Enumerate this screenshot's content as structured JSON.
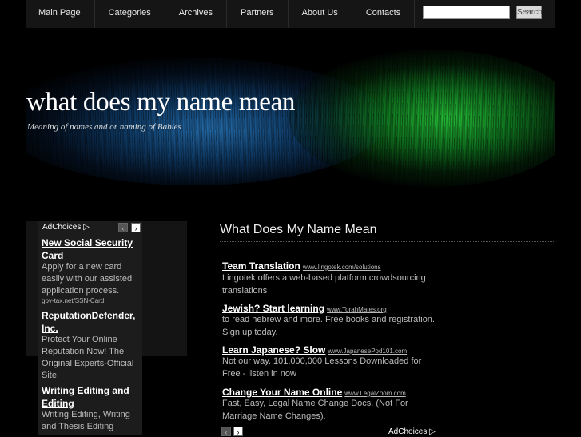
{
  "nav": {
    "items": [
      "Main Page",
      "Categories",
      "Archives",
      "Partners",
      "About Us",
      "Contacts"
    ],
    "search_button": "Search",
    "search_value": ""
  },
  "header": {
    "title": "what does my name mean",
    "tagline": "Meaning of names and or naming of Babies"
  },
  "sidebar": {
    "adchoices": "AdChoices",
    "ads": [
      {
        "title": "New Social Security Card",
        "description": "Apply for a new card easily with our assisted application process.",
        "url": "gov-tax.net/SSN-Card"
      },
      {
        "title": "ReputationDefender, Inc.",
        "description": "Protect Your Online Reputation Now! The Original Experts-Official Site.",
        "url": ""
      },
      {
        "title": "Writing Editing and Editing",
        "description": "Writing Editing, Writing and Thesis Editing",
        "url": ""
      }
    ]
  },
  "main": {
    "heading": "What Does My Name Mean",
    "adchoices": "AdChoices",
    "ads": [
      {
        "title": "Team Translation",
        "url": "www.lingotek.com/solutions",
        "description": "Lingotek offers a web-based platform crowdsourcing translations"
      },
      {
        "title": "Jewish? Start learning",
        "url": "www.TorahMates.org",
        "description": "to read hebrew and more. Free books and registration. Sign up today."
      },
      {
        "title": "Learn Japanese? Slow",
        "url": "www.JapanesePod101.com",
        "description": "Not our way. 101,000,000 Lessons Downloaded for Free - listen in now"
      },
      {
        "title": "Change Your Name Online",
        "url": "www.LegalZoom.com",
        "description": "Fast, Easy, Legal Name Change Docs. (Not For Marriage Name Changes)."
      }
    ]
  }
}
